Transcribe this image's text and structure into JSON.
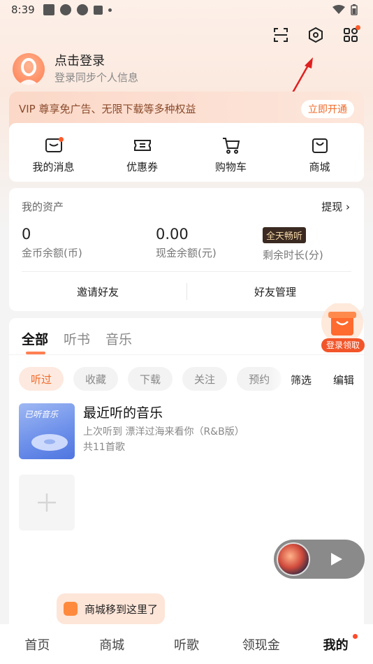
{
  "status_bar": {
    "time": "8:39"
  },
  "header": {
    "login_title": "点击登录",
    "login_subtitle": "登录同步个人信息"
  },
  "vip": {
    "text": "VIP 尊享免广告、无限下载等多种权益",
    "button": "立即开通"
  },
  "quick_actions": [
    {
      "label": "我的消息",
      "icon": "message-icon"
    },
    {
      "label": "优惠券",
      "icon": "coupon-icon"
    },
    {
      "label": "购物车",
      "icon": "cart-icon"
    },
    {
      "label": "商城",
      "icon": "shop-bag-icon"
    }
  ],
  "assets": {
    "title": "我的资产",
    "withdraw": "提现 ›",
    "coins_value": "0",
    "coins_label": "金币余额(币)",
    "cash_value": "0.00",
    "cash_label": "现金余额(元)",
    "time_badge": "全天畅听",
    "time_label": "剩余时长(分)",
    "invite": "邀请好友",
    "manage": "好友管理"
  },
  "tabs": [
    "全部",
    "听书",
    "音乐"
  ],
  "chips": [
    "听过",
    "收藏",
    "下载",
    "关注",
    "预约"
  ],
  "filter_label": "筛选",
  "edit_label": "编辑",
  "album": {
    "cover_text": "已听音乐",
    "title": "最近听的音乐",
    "subtitle": "上次听到 漂洋过海来看你（R&B版）",
    "count": "共11首歌"
  },
  "gift_label": "登录领取",
  "tooltip": "商城移到这里了",
  "bottom_nav": [
    "首页",
    "商城",
    "听歌",
    "领现金",
    "我的"
  ],
  "colors": {
    "accent": "#f06a2a",
    "vip_bg": "#fbd8c8",
    "badge_dark": "#3a2a22"
  }
}
